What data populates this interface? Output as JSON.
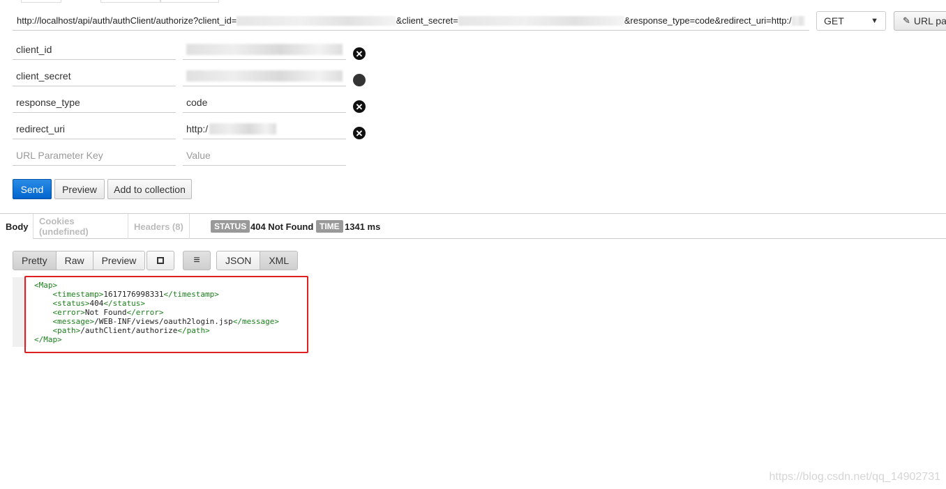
{
  "request": {
    "url_parts": {
      "base": "http://localhost/api/auth/authClient/authorize?client_id=",
      "mid1": "&client_secret=",
      "mid2": "&response_type=code&redirect_uri=http:/"
    },
    "method": "GET",
    "url_params_label": "URL pa"
  },
  "params": [
    {
      "key": "client_id",
      "value": ""
    },
    {
      "key": "client_secret",
      "value": ""
    },
    {
      "key": "response_type",
      "value": "code"
    },
    {
      "key": "redirect_uri",
      "value": "http:/"
    }
  ],
  "new_param": {
    "key_placeholder": "URL Parameter Key",
    "value_placeholder": "Value"
  },
  "actions": {
    "send": "Send",
    "preview": "Preview",
    "add_to_collection": "Add to collection"
  },
  "response": {
    "tabs": {
      "body": "Body",
      "cookies": "Cookies (undefined)",
      "headers": "Headers (8)"
    },
    "status_label": "STATUS",
    "status_value": "404 Not Found",
    "time_label": "TIME",
    "time_value": "1341 ms"
  },
  "format": {
    "pretty": "Pretty",
    "raw": "Raw",
    "preview": "Preview",
    "json": "JSON",
    "xml": "XML"
  },
  "body": {
    "l1": "<Map>",
    "timestamp": "1617176998331",
    "status": "404",
    "error": "Not Found",
    "message": "/WEB-INF/views/oauth2login.jsp",
    "path": "/authClient/authorize",
    "l7": "</Map>"
  },
  "watermark": "https://blog.csdn.net/qq_14902731"
}
